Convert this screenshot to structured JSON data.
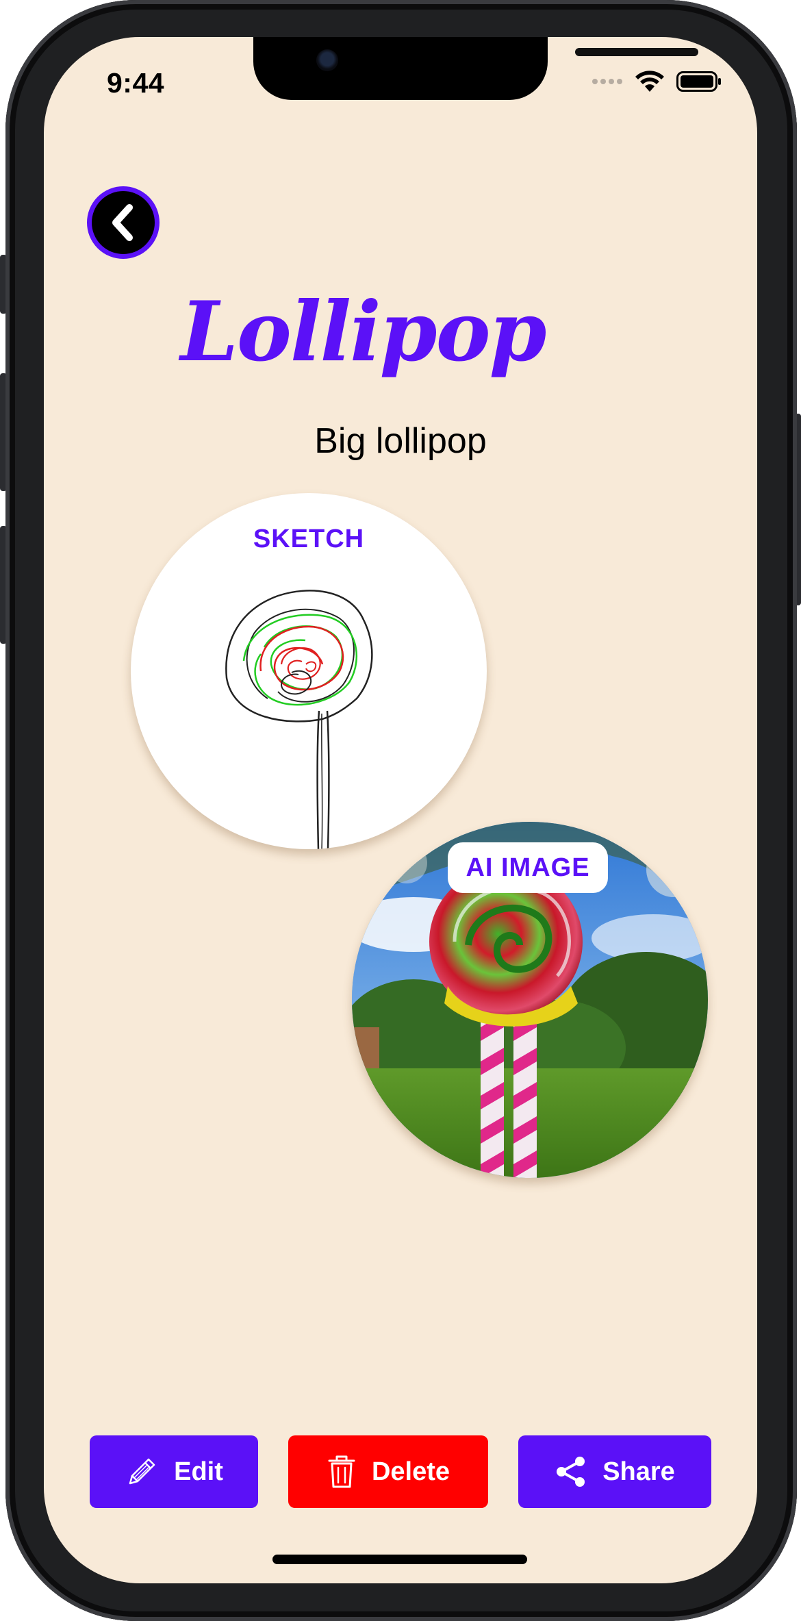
{
  "status_bar": {
    "time": "9:44"
  },
  "navigation": {
    "back_icon": "chevron-left-icon"
  },
  "artwork": {
    "title": "Lollipop",
    "description": "Big lollipop"
  },
  "sketch": {
    "label": "SKETCH"
  },
  "ai_image": {
    "label": "AI IMAGE"
  },
  "actions": {
    "edit_label": "Edit",
    "delete_label": "Delete",
    "share_label": "Share"
  },
  "colors": {
    "accent": "#5b11f7",
    "danger": "#ff0000",
    "background": "#f8ead8"
  }
}
